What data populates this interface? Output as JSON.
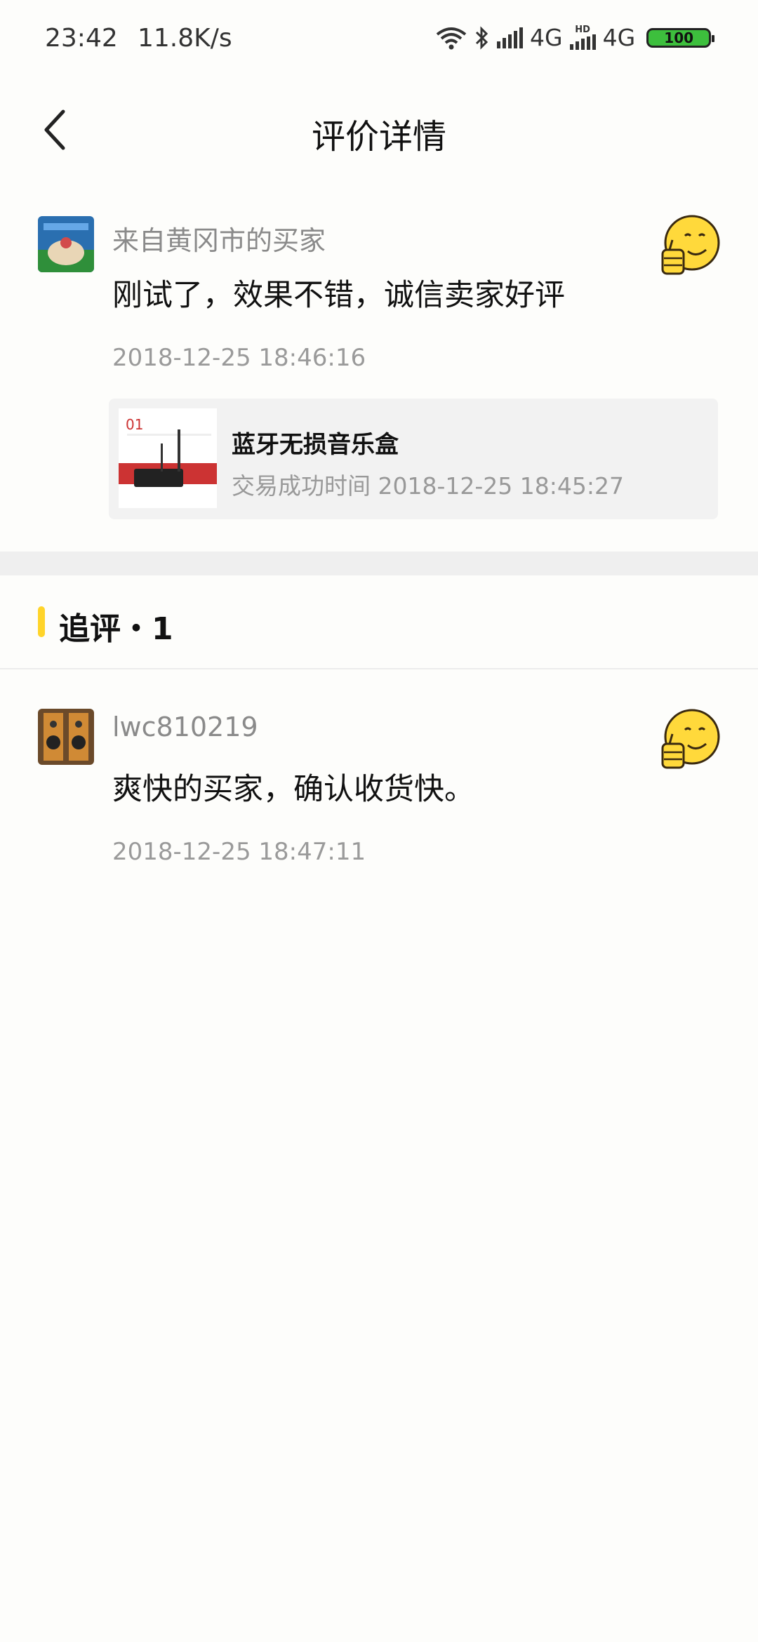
{
  "status_bar": {
    "time": "23:42",
    "net_speed": "11.8K/s",
    "network1": "4G",
    "network2": "4G",
    "hd_label": "HD",
    "battery": "100",
    "battery_color": "#3dbf3d"
  },
  "header": {
    "title": "评价详情"
  },
  "review": {
    "username": "来自黄冈市的买家",
    "text": "刚试了，效果不错，诚信卖家好评",
    "time": "2018-12-25 18:46:16",
    "rating_icon": "thumbs-up-emoji-icon",
    "product": {
      "title": "蓝牙无损音乐盒",
      "label_prefix": "交易成功时间",
      "trade_time": "2018-12-25 18:45:27"
    }
  },
  "followup": {
    "label": "追评・1",
    "accent_color": "#ffd42a",
    "items": [
      {
        "username": "lwc810219",
        "text": "爽快的买家，确认收货快。",
        "time": "2018-12-25 18:47:11",
        "rating_icon": "thumbs-up-emoji-icon"
      }
    ]
  }
}
